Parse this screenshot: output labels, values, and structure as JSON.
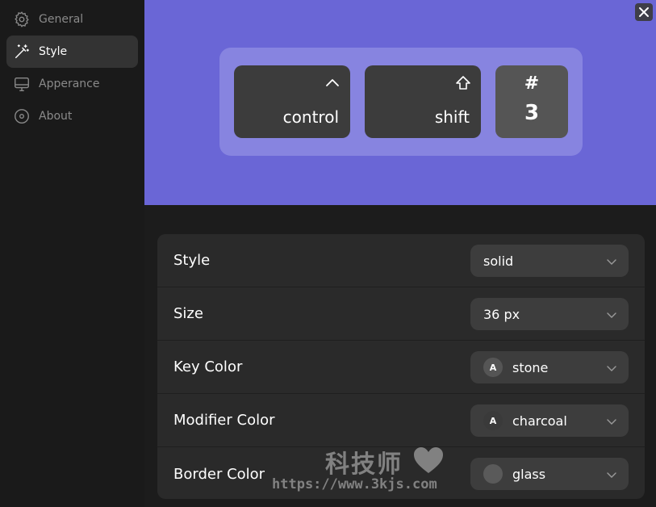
{
  "sidebar": {
    "items": [
      {
        "label": "General",
        "icon": "gear-icon",
        "active": false
      },
      {
        "label": "Style",
        "icon": "magic-wand-icon",
        "active": true
      },
      {
        "label": "Apperance",
        "icon": "monitor-icon",
        "active": false
      },
      {
        "label": "About",
        "icon": "info-circle-icon",
        "active": false
      }
    ]
  },
  "preview": {
    "background": "#6a66d6",
    "keys": [
      {
        "label": "control",
        "glyph": "^"
      },
      {
        "label": "shift",
        "glyph": "⇧"
      },
      {
        "symbol": "#",
        "label": "3"
      }
    ]
  },
  "settings": {
    "rows": [
      {
        "label": "Style",
        "value": "solid"
      },
      {
        "label": "Size",
        "value": "36 px"
      },
      {
        "label": "Key Color",
        "value": "stone",
        "swatch_text": "A",
        "swatch_color": "#555555"
      },
      {
        "label": "Modifier Color",
        "value": "charcoal",
        "swatch_text": "A",
        "swatch_color": "#3a3a3a"
      },
      {
        "label": "Border Color",
        "value": "glass",
        "swatch_text": "",
        "swatch_color": "#5a5a5a"
      }
    ]
  },
  "watermark": {
    "title": "科技师",
    "url": "https://www.3kjs.com"
  }
}
